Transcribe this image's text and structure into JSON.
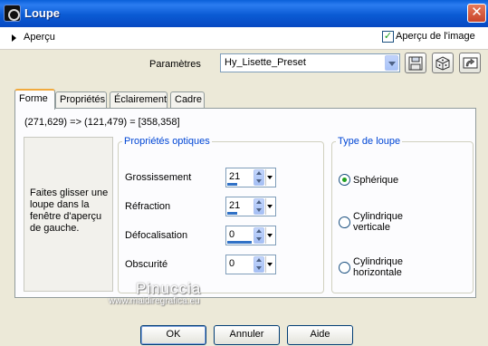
{
  "window": {
    "title": "Loupe",
    "close_glyph": "✕",
    "icon": "app-icon"
  },
  "preview_bar": {
    "toggle_label": "Aperçu",
    "image_preview_label": "Aperçu de l'image",
    "image_preview_checked": true,
    "check_glyph": "✓"
  },
  "params": {
    "label": "Paramètres",
    "preset_value": "Hy_Lisette_Preset",
    "buttons": [
      "save-preset-icon",
      "random-params-icon",
      "reset-params-icon"
    ]
  },
  "tabs": [
    {
      "label": "Forme",
      "active": true
    },
    {
      "label": "Propriétés"
    },
    {
      "label": "Éclairement"
    },
    {
      "label": "Cadre"
    }
  ],
  "coords_text": "(271,629) => (121,479) = [358,358]",
  "drag_hint": "Faites glisser une loupe dans la fenêtre d'aperçu de gauche.",
  "optical": {
    "legend": "Propriétés optiques",
    "fields": [
      {
        "label": "Grossissement",
        "value": "21"
      },
      {
        "label": "Réfraction",
        "value": "21"
      },
      {
        "label": "Défocalisation",
        "value": "0"
      },
      {
        "label": "Obscurité",
        "value": "0"
      }
    ]
  },
  "loupe_type": {
    "legend": "Type de loupe",
    "options": [
      {
        "label": "Sphérique",
        "selected": true
      },
      {
        "label": "Cylindrique verticale"
      },
      {
        "label": "Cylindrique horizontale"
      }
    ]
  },
  "watermark": {
    "name": "Pinuccia",
    "url": "www.maidiregrafica.eu"
  },
  "buttons": {
    "ok": "OK",
    "cancel": "Annuler",
    "help": "Aide"
  },
  "colors": {
    "title_bar": "#0a5fd8",
    "legend_text": "#0046d5",
    "active_tab_accent": "#f1aa3e",
    "check_green": "#21a121"
  }
}
